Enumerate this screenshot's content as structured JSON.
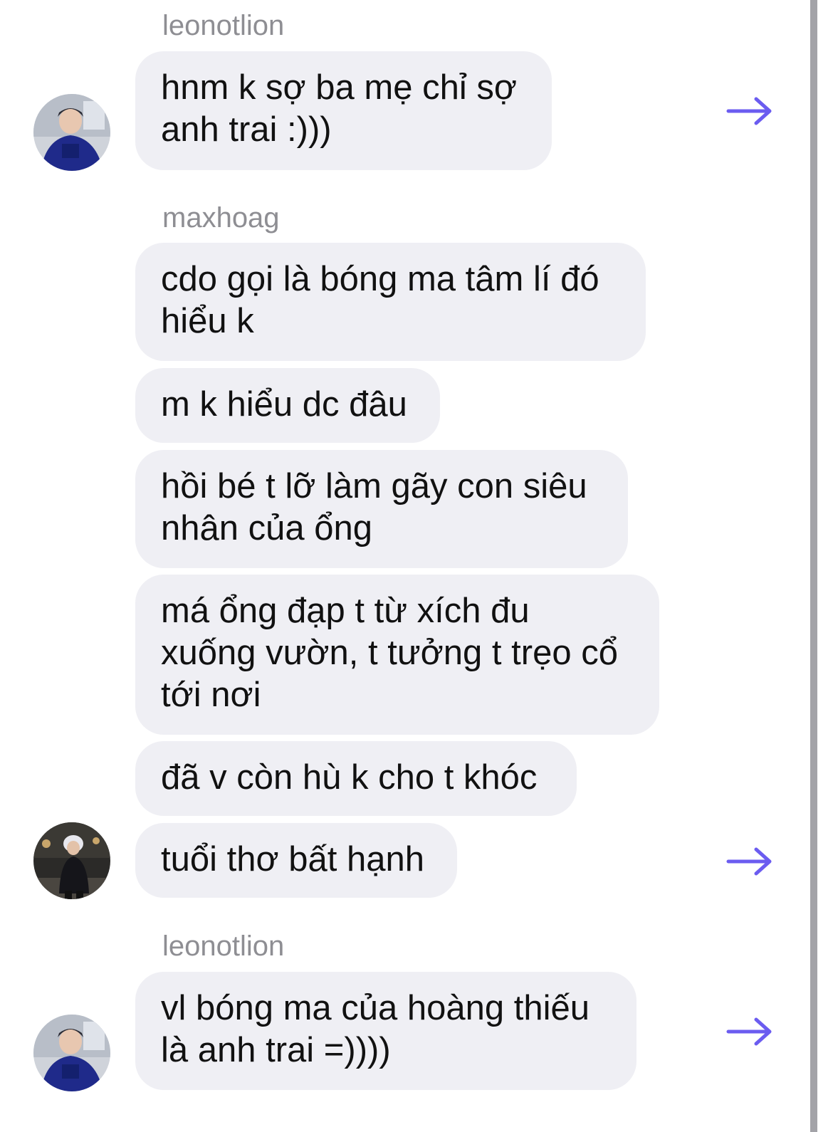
{
  "thread": {
    "groups": [
      {
        "sender": "leonotlion",
        "messages": [
          "hnm k sợ ba mẹ chỉ sợ anh trai :)))"
        ]
      },
      {
        "sender": "maxhoag",
        "messages": [
          "cdo gọi là bóng ma tâm lí đó hiểu k",
          "m k hiểu dc đâu",
          "hồi bé t lỡ làm gãy con siêu nhân của ổng",
          "má ổng đạp t từ xích đu xuống vườn, t tưởng t trẹo cổ tới nơi",
          "đã v còn hù k cho t khóc",
          "tuổi thơ bất hạnh"
        ]
      },
      {
        "sender": "leonotlion",
        "messages": [
          "vl bóng ma của hoàng thiếu là anh trai =))))"
        ]
      }
    ]
  },
  "icons": {
    "share": "share-arrow-icon",
    "avatar": "profile-photo"
  },
  "colors": {
    "bubble": "#efeff4",
    "text": "#111111",
    "sender": "#8e8e93",
    "share_arrow": "#6b5cf0",
    "scrollbar": "#a3a3a8"
  }
}
